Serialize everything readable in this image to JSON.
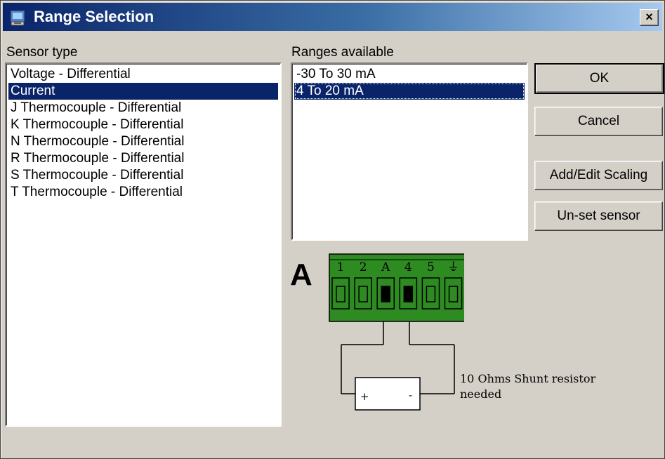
{
  "window": {
    "title": "Range Selection",
    "close_label": "×"
  },
  "sensor": {
    "label": "Sensor type",
    "items": [
      "Voltage - Differential",
      "Current",
      "J Thermocouple - Differential",
      "K Thermocouple - Differential",
      "N Thermocouple - Differential",
      "R Thermocouple - Differential",
      "S Thermocouple - Differential",
      "T Thermocouple - Differential"
    ],
    "selected": "Current"
  },
  "ranges": {
    "label": "Ranges available",
    "items": [
      "-30 To 30 mA",
      "4 To 20 mA"
    ],
    "selected": "4 To 20 mA"
  },
  "buttons": {
    "ok": "OK",
    "cancel": "Cancel",
    "scaling": "Add/Edit Scaling",
    "unset": "Un-set sensor"
  },
  "diagram": {
    "channel": "A",
    "pins": [
      "1",
      "2",
      "A",
      "4",
      "5",
      "⏚"
    ],
    "plus": "+",
    "minus": "-",
    "connector_color": "#2e8b22",
    "note_line1": "10 Ohms Shunt resistor",
    "note_line2": "needed"
  }
}
